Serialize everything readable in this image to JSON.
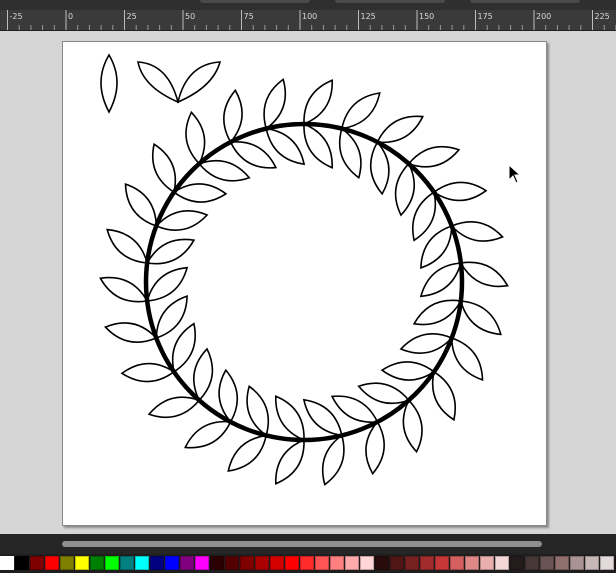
{
  "ruler": {
    "labels": [
      "-25",
      "0",
      "25",
      "50",
      "75",
      "100",
      "125",
      "150",
      "175",
      "200",
      "225"
    ]
  },
  "canvas": {
    "page_color": "#ffffff",
    "desk_color": "#d6d6d6",
    "stroke_color": "#000000"
  },
  "palette": {
    "colors": [
      "#000000",
      "#800000",
      "#ff0000",
      "#808000",
      "#ffff00",
      "#008000",
      "#00ff00",
      "#008080",
      "#00ffff",
      "#000080",
      "#0000ff",
      "#800080",
      "#ff00ff",
      "#2b0000",
      "#550000",
      "#800000",
      "#aa0000",
      "#d40000",
      "#ff0000",
      "#ff2a2a",
      "#ff5555",
      "#ff8080",
      "#ffaaaa",
      "#ffd5d5",
      "#280b0b",
      "#501616",
      "#782121",
      "#a02c2c",
      "#c83737",
      "#d35f5f",
      "#de8787",
      "#e9afaf",
      "#f4d7d7",
      "#241c1c",
      "#483737",
      "#6c5353",
      "#916f6f",
      "#ac9393",
      "#c8b7b7",
      "#e3dbdb",
      "#280b0b"
    ]
  }
}
